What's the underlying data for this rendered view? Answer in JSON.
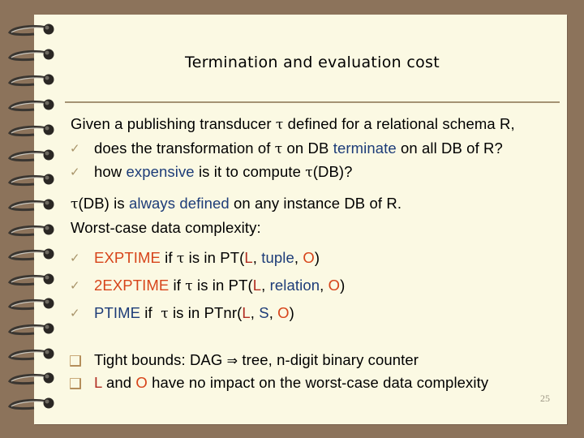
{
  "slide": {
    "title": "Termination and evaluation cost",
    "page_number": "25",
    "colors": {
      "background": "#8c735b",
      "paper": "#fbf9e3",
      "blue": "#1d3c78",
      "red": "#b12d22",
      "orange": "#d7441a",
      "check": "#a8946a"
    }
  },
  "intro": {
    "given_prefix": "Given a publishing transducer ",
    "tau": "τ",
    "given_suffix": " defined for a relational schema R,"
  },
  "questions": [
    {
      "icon": "checkmark-icon",
      "part1": "does the transformation of ",
      "tau": "τ",
      "part2": " on DB ",
      "highlight": "terminate",
      "part3": " on all DB of R?"
    },
    {
      "icon": "checkmark-icon",
      "part1": "how ",
      "highlight": "expensive",
      "part2": " is it to compute ",
      "tau": "τ",
      "part3": "(DB)?"
    }
  ],
  "statement": {
    "tau": "τ",
    "part1": "(DB) is ",
    "highlight": "always defined",
    "part2": " on any instance DB of R.",
    "line2": "Worst-case data complexity:"
  },
  "complexity": [
    {
      "icon": "checkmark-icon",
      "class": "EXPTIME",
      "mid": " if ",
      "tau": "τ",
      "mid2": " is in PT(",
      "L": "L",
      "sep1": ", ",
      "S": "tuple",
      "sep2": ", ",
      "O": "O",
      "end": ")"
    },
    {
      "icon": "checkmark-icon",
      "class": "2EXPTIME",
      "mid": " if ",
      "tau": "τ",
      "mid2": " is in PT(",
      "L": "L",
      "sep1": ", ",
      "S": "relation",
      "sep2": ", ",
      "O": "O",
      "end": ")"
    },
    {
      "icon": "checkmark-icon",
      "class": "PTIME",
      "mid": " if  ",
      "tau": "τ",
      "mid2": " is in PTnr(",
      "L": "L",
      "sep1": ", ",
      "S": "S",
      "sep2": ", ",
      "O": "O",
      "end": ")"
    }
  ],
  "notes": [
    {
      "icon": "square-bullet-icon",
      "text_prefix": "Tight bounds: DAG ",
      "arrow": "⇒",
      "text_suffix": " tree, n-digit binary counter"
    },
    {
      "icon": "square-bullet-icon",
      "L": "L",
      "mid": " and ",
      "O": "O",
      "suffix": " have no impact on the worst-case data complexity"
    }
  ]
}
